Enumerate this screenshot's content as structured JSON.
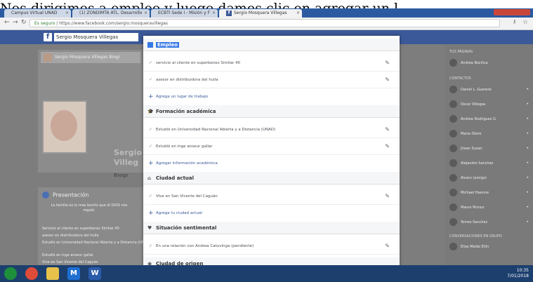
{
  "caption": "Nos dirigimos a empleo y luego damos clic en agregar un l",
  "browser": {
    "tabs": [
      {
        "label": "Campus Virtual UNAD"
      },
      {
        "label": "(1) ZONDIMTA ATL. Desarrollo"
      },
      {
        "label": "ECBTI Sede I - Misión y F"
      },
      {
        "label": "Sergio Mosquera Villegas"
      }
    ],
    "url_secure": "Es seguro",
    "url": "https://www.facebook.com/sergio.mosqueravillegas"
  },
  "fb": {
    "search_text": "Sergio Mosquera Villegas",
    "cover_namebar": "Sergio Mosquera Villegas   Biogr",
    "cover_name_line1": "Sergio",
    "cover_name_line2": "Villeg",
    "biografia": "Biogr",
    "intro": {
      "title": "Presentación",
      "text": "La familia es lo mas bonito que dí DIOS nos regaló.",
      "lines": [
        "Servicio al cliente en superbenes Similar 40",
        "asesor en distribuidora del huila",
        "Estudió en Universidad Nacional Abierta y a Distancia (UNAD)",
        "Estudió en inge anseur gallar",
        "Vive en San Vicente del Caguán"
      ]
    },
    "right": {
      "head1": "TUS PÁGINAS",
      "page_item": "Andrea Bocilica",
      "head2": "CONTACTOS",
      "contacts": [
        "Daniel L. Guerere",
        "Oscar Villegas",
        "Andrea Rodriguez G.",
        "Maria Otero",
        "Jhoan Suzan",
        "Alejandro Sanchez",
        "Alvaro (amigo)",
        "Michael Haenne",
        "Mauro Munoz",
        "Yorreo Sanchez"
      ],
      "head3": "CONVERSACIONES EN GRUPO",
      "group": "Elias Maldo Ellin"
    }
  },
  "modal": {
    "sections": [
      {
        "title": "Empleo",
        "icon": "briefcase-icon",
        "rows": [
          "servicio al cliente en superbenes Similar 40",
          "asesor en distribuidora del huila"
        ],
        "add": "Agrega un lugar de trabajo"
      },
      {
        "title": "Formación académica",
        "icon": "graduation-cap-icon",
        "rows": [
          "Estudió en Universidad Nacional Abierta y a Distancia (UNAD)",
          "Estudió en inge anseur gallar"
        ],
        "add": "Agregar información académica"
      },
      {
        "title": "Ciudad actual",
        "icon": "home-icon",
        "rows": [
          "Vive en San Vicente del Caguán"
        ],
        "add": "Agrega tu ciudad actual"
      },
      {
        "title": "Situación sentimental",
        "icon": "heart-icon",
        "rows": [
          "En una relación con Andrea Catuvinga (pendiente)"
        ],
        "add": ""
      },
      {
        "title": "Ciudad de origen",
        "icon": "location-pin-icon",
        "rows": [],
        "add": ""
      }
    ]
  },
  "taskbar": {
    "time": "10:35",
    "date": "7/01/2018"
  }
}
